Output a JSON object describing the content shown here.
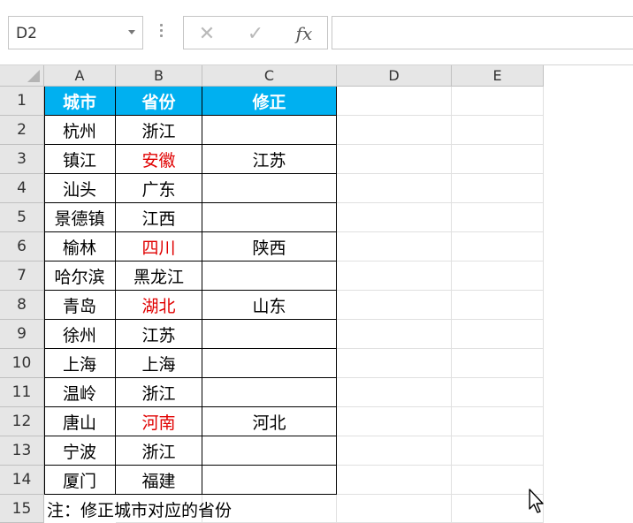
{
  "formula_bar": {
    "name_box": "D2",
    "cancel_icon": "✕",
    "enter_icon": "✓",
    "fx_label": "fx",
    "formula": ""
  },
  "columns": [
    "A",
    "B",
    "C",
    "D",
    "E"
  ],
  "rows": [
    "1",
    "2",
    "3",
    "4",
    "5",
    "6",
    "7",
    "8",
    "9",
    "10",
    "11",
    "12",
    "13",
    "14",
    "15"
  ],
  "table": {
    "headers": [
      "城市",
      "省份",
      "修正"
    ],
    "body": [
      [
        "杭州",
        "浙江",
        ""
      ],
      [
        "镇江",
        "安徽",
        "江苏"
      ],
      [
        "汕头",
        "广东",
        ""
      ],
      [
        "景德镇",
        "江西",
        ""
      ],
      [
        "榆林",
        "四川",
        "陕西"
      ],
      [
        "哈尔滨",
        "黑龙江",
        ""
      ],
      [
        "青岛",
        "湖北",
        "山东"
      ],
      [
        "徐州",
        "江苏",
        ""
      ],
      [
        "上海",
        "上海",
        ""
      ],
      [
        "温岭",
        "浙江",
        ""
      ],
      [
        "唐山",
        "河南",
        "河北"
      ],
      [
        "宁波",
        "浙江",
        ""
      ],
      [
        "厦门",
        "福建",
        ""
      ]
    ],
    "red_rows": [
      1,
      4,
      6,
      10
    ]
  },
  "note": "注：修正城市对应的省份",
  "colors": {
    "header_fill": "#00b0f0",
    "header_text": "#ffffff",
    "wrong_province": "#e00000"
  }
}
